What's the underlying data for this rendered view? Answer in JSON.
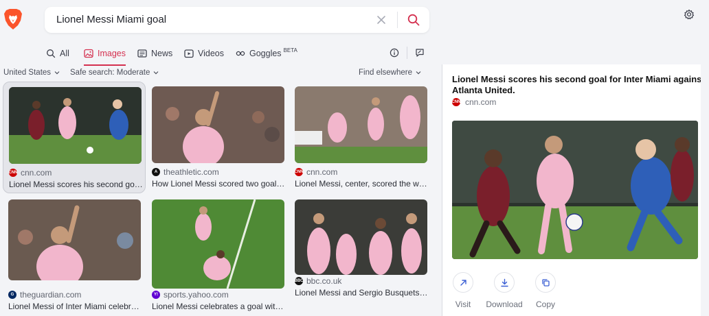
{
  "search": {
    "query": "Lionel Messi Miami goal"
  },
  "icons": {
    "logo": "brave-lion-icon",
    "clear": "close-icon",
    "search": "search-icon",
    "settings": "gear-icon",
    "info": "info-icon",
    "feedback": "feedback-icon"
  },
  "colors": {
    "accent": "#d4304f",
    "brave_orange": "#fb542b",
    "pitch_green": "#5f8f3e",
    "inter_pink": "#f2b6cc"
  },
  "tabs": [
    {
      "label": "All",
      "icon": "search-icon"
    },
    {
      "label": "Images",
      "icon": "image-icon",
      "active": true
    },
    {
      "label": "News",
      "icon": "news-icon"
    },
    {
      "label": "Videos",
      "icon": "video-icon"
    },
    {
      "label": "Goggles",
      "icon": "goggles-icon",
      "badge": "BETA"
    }
  ],
  "filters": {
    "country": "United States",
    "safe_search": "Safe search: Moderate",
    "find_elsewhere": "Find elsewhere"
  },
  "results": [
    {
      "source": "cnn.com",
      "favicon": "cnn-logo-icon",
      "caption": "Lionel Messi scores his second goal for Inter Miami against Atlanta United.",
      "selected": true
    },
    {
      "source": "theathletic.com",
      "favicon": "athletic-logo-icon",
      "caption": "How Lionel Messi scored two goals in Inter Miami's win"
    },
    {
      "source": "cnn.com",
      "favicon": "cnn-logo-icon",
      "caption": "Lionel Messi, center, scored the winning goal"
    },
    {
      "source": "theguardian.com",
      "favicon": "guardian-logo-icon",
      "caption": "Lionel Messi of Inter Miami celebrates after scoring"
    },
    {
      "source": "sports.yahoo.com",
      "favicon": "yahoo-logo-icon",
      "caption": "Lionel Messi celebrates a goal with Inter Miami"
    },
    {
      "source": "bbc.co.uk",
      "favicon": "bbc-logo-icon",
      "caption": "Lionel Messi and Sergio Busquets celebrate"
    }
  ],
  "panel": {
    "title": "Lionel Messi scores his second goal for Inter Miami against Atlanta United.",
    "source": "cnn.com",
    "actions": [
      {
        "label": "Visit",
        "icon": "external-link-icon"
      },
      {
        "label": "Download",
        "icon": "download-icon"
      },
      {
        "label": "Copy",
        "icon": "copy-icon"
      }
    ]
  }
}
